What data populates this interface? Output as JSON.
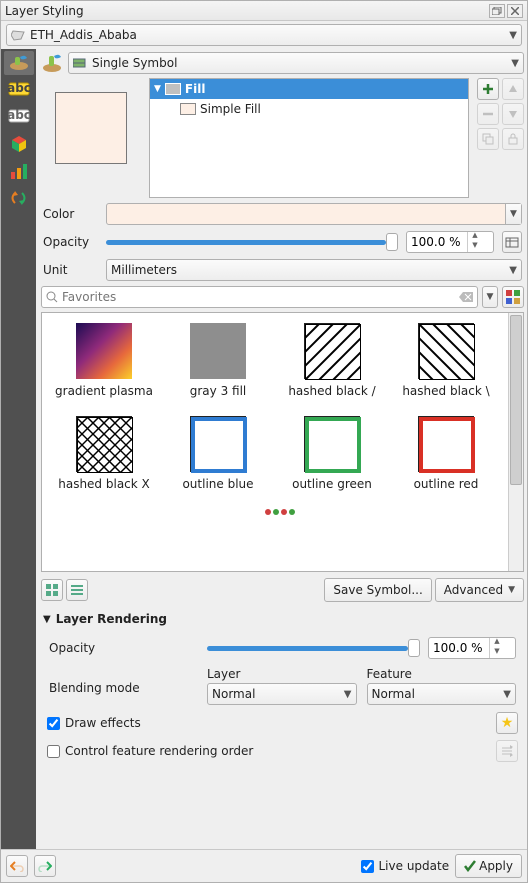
{
  "panel_title": "Layer Styling",
  "layer_selector": {
    "value": "ETH_Addis_Ababa"
  },
  "symbol_type": {
    "label": "Single Symbol"
  },
  "fill_color_hex": "#fdefe5",
  "symbol_layers": {
    "root": "Fill",
    "child": "Simple Fill"
  },
  "color": {
    "label": "Color"
  },
  "opacity": {
    "label": "Opacity",
    "value": "100.0 %"
  },
  "unit": {
    "label": "Unit",
    "value": "Millimeters"
  },
  "search": {
    "placeholder": "Favorites"
  },
  "styles": [
    {
      "name": "gradient plasma",
      "type": "gradient"
    },
    {
      "name": "gray 3 fill",
      "type": "flat",
      "fill": "#8e8e8e"
    },
    {
      "name": "hashed black /",
      "type": "hatch_f"
    },
    {
      "name": "hashed black \\",
      "type": "hatch_b"
    },
    {
      "name": "hashed black X",
      "type": "hatch_x"
    },
    {
      "name": "outline blue",
      "type": "outline",
      "stroke": "#2f7cd2"
    },
    {
      "name": "outline green",
      "type": "outline",
      "stroke": "#34a853"
    },
    {
      "name": "outline red",
      "type": "outline",
      "stroke": "#d93025"
    }
  ],
  "list_buttons": {
    "save": "Save Symbol...",
    "advanced": "Advanced"
  },
  "rendering": {
    "title": "Layer Rendering",
    "opacity_label": "Opacity",
    "opacity_value": "100.0 %",
    "blending_label": "Blending mode",
    "layer_label": "Layer",
    "feature_label": "Feature",
    "layer_value": "Normal",
    "feature_value": "Normal",
    "draw_effects": "Draw effects",
    "control_order": "Control feature rendering order"
  },
  "footer": {
    "live_update": "Live update",
    "apply": "Apply"
  }
}
